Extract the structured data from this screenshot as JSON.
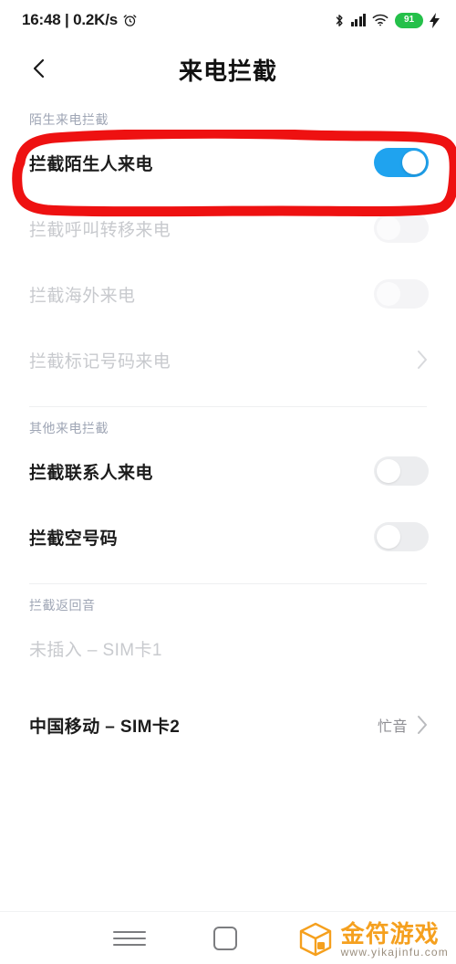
{
  "status_bar": {
    "time": "16:48 | 0.2K/s",
    "alarm_icon": "alarm-clock-icon",
    "bluetooth_icon": "bluetooth-icon",
    "signal_icon": "cellular-signal-icon",
    "wifi_icon": "wifi-icon",
    "battery_level": "91",
    "battery_color": "#25c04a",
    "charging_icon": "charging-bolt-icon"
  },
  "header": {
    "back_icon": "back-chevron-icon",
    "title": "来电拦截"
  },
  "sections": [
    {
      "title": "陌生来电拦截",
      "rows": [
        {
          "label": "拦截陌生人来电",
          "control": "toggle",
          "state": "on",
          "disabled": false
        },
        {
          "label": "拦截呼叫转移来电",
          "control": "toggle",
          "state": "off",
          "disabled": true
        },
        {
          "label": "拦截海外来电",
          "control": "toggle",
          "state": "off",
          "disabled": true
        },
        {
          "label": "拦截标记号码来电",
          "control": "chevron",
          "disabled": true
        }
      ]
    },
    {
      "title": "其他来电拦截",
      "rows": [
        {
          "label": "拦截联系人来电",
          "control": "toggle",
          "state": "off",
          "disabled": false
        },
        {
          "label": "拦截空号码",
          "control": "toggle",
          "state": "off",
          "disabled": false
        }
      ]
    },
    {
      "title": "拦截返回音",
      "rows": [
        {
          "label": "未插入 – SIM卡1",
          "control": "none",
          "disabled": true
        },
        {
          "label": "中国移动 – SIM卡2",
          "control": "chevron",
          "value": "忙音",
          "disabled": false
        }
      ]
    }
  ],
  "annotation": {
    "shape": "hand-drawn-rectangle",
    "color": "#ee1111",
    "targets": "拦截陌生人来电"
  },
  "nav_bar": {
    "recents_icon": "hamburger-recents-icon",
    "home_icon": "square-home-icon"
  },
  "watermark": {
    "logo_icon": "orange-cube-logo-icon",
    "brand": "金符游戏",
    "url": "www.yikajinfu.com",
    "color": "#f5a01e"
  },
  "toggle_on_color": "#1fa3ef"
}
